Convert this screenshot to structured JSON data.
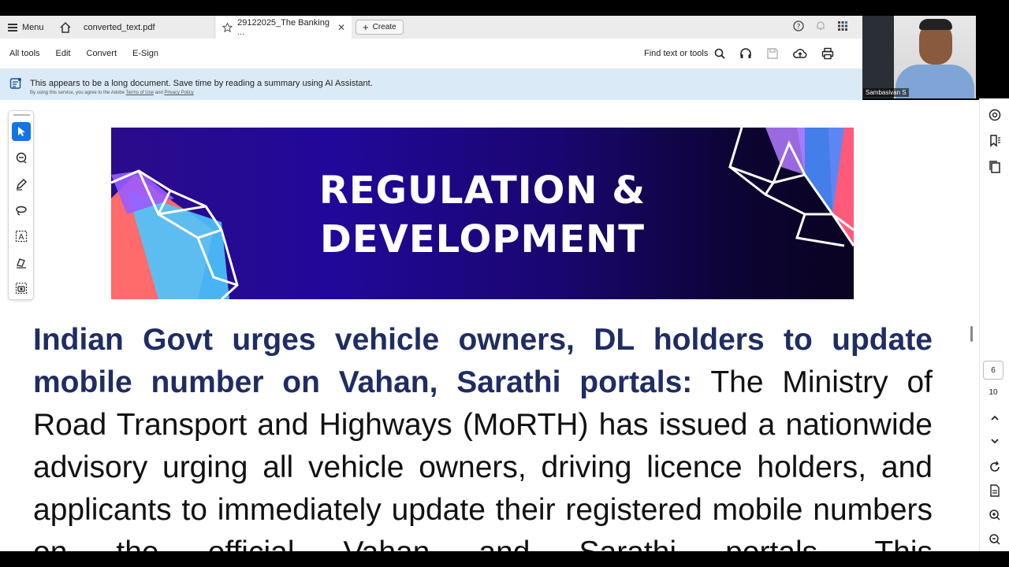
{
  "tabbar": {
    "menu_label": "Menu",
    "tabs": [
      {
        "label": "converted_text.pdf"
      },
      {
        "label": "29122025_The Banking ..."
      }
    ],
    "close_glyph": "✕",
    "create_label": "Create"
  },
  "toolbar": {
    "items": [
      "All tools",
      "Edit",
      "Convert",
      "E-Sign"
    ],
    "find_label": "Find text or tools"
  },
  "ai_banner": {
    "message": "This appears to be a long document. Save time by reading a summary using AI Assistant.",
    "fine_prefix": "By using this service, you agree to the Adobe",
    "terms": "Terms of Use",
    "and": "and",
    "privacy": "Privacy Policy"
  },
  "video": {
    "participant_name": "Sambasivan S"
  },
  "document": {
    "hero_line1": "REGULATION &",
    "hero_line2": "DEVELOPMENT",
    "headline": "Indian Govt urges vehicle owners, DL holders to update mobile number on Vahan, Sarathi portals:",
    "body": " The Ministry of Road Transport and Highways (MoRTH) has issued a nationwide advisory urging all vehicle owners, driving licence holders, and applicants to immediately update their registered mobile numbers on the official Vahan and Sarathi portals. This"
  },
  "navigation": {
    "current_page": "6",
    "total_pages": "10"
  },
  "colors": {
    "accent": "#1473e6",
    "headline": "#1f2d63",
    "banner_bg": "#dbeaf7"
  }
}
